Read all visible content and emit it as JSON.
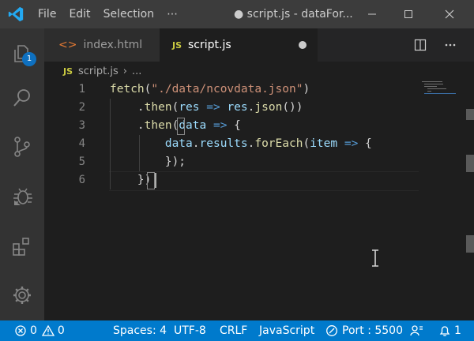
{
  "menu": {
    "file": "File",
    "edit": "Edit",
    "selection": "Selection",
    "more": "⋯"
  },
  "window": {
    "title": "● script.js - dataFor..."
  },
  "activity": {
    "explorer_badge": "1"
  },
  "tabs": [
    {
      "label": "index.html",
      "icon": "html-icon"
    },
    {
      "label": "script.js",
      "icon": "js-icon",
      "dirty": true
    }
  ],
  "breadcrumb": {
    "file_icon": "JS",
    "file": "script.js",
    "sep": "›",
    "more": "..."
  },
  "tab_icon_js": "JS",
  "tab_icon_html": "<>",
  "line_numbers": [
    "1",
    "2",
    "3",
    "4",
    "5",
    "6"
  ],
  "code": {
    "l1": {
      "fn": "fetch",
      "p1": "(",
      "str": "\"./data/ncovdata.json\"",
      "p2": ")"
    },
    "l2": {
      "p1": ".",
      "fn": "then",
      "p2": "(",
      "v1": "res",
      "arrow": "=>",
      "v2": "res",
      "p3": ".",
      "fn2": "json",
      "p4": "())"
    },
    "l3": {
      "p1": ".",
      "fn": "then",
      "p2": "(",
      "v1": "data",
      "arrow": "=>",
      "p3": "{"
    },
    "l4": {
      "v1": "data",
      "p1": ".",
      "v2": "results",
      "p2": ".",
      "fn": "forEach",
      "p3": "(",
      "v3": "item",
      "arrow": "=>",
      "p4": "{"
    },
    "l5": {
      "p1": "});"
    },
    "l6": {
      "p1": "})"
    }
  },
  "status": {
    "errors": "0",
    "warnings": "0",
    "spaces": "Spaces: 4",
    "encoding": "UTF-8",
    "eol": "CRLF",
    "language": "JavaScript",
    "port": "Port : 5500",
    "notifications": "1"
  },
  "colors": {
    "accent": "#007acc",
    "titlebar": "#3c3c3c",
    "activitybar": "#333333",
    "editor_bg": "#1e1e1e",
    "badge": "#0e70c0"
  }
}
